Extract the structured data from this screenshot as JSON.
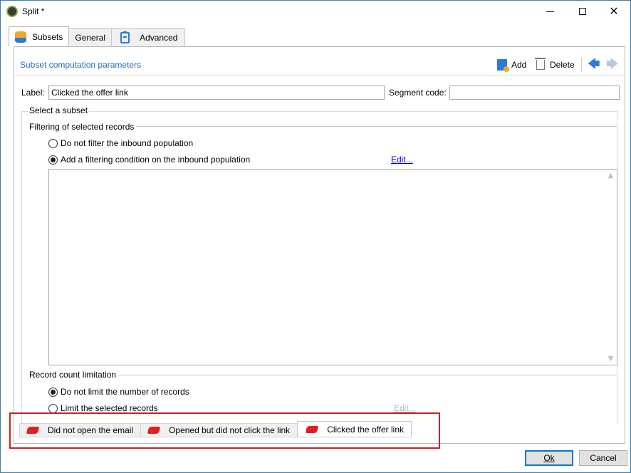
{
  "window": {
    "title": "Split *"
  },
  "tabs": [
    {
      "label": "Subsets",
      "icon": "database-icon",
      "active": true
    },
    {
      "label": "General",
      "icon": "",
      "active": false
    },
    {
      "label": "Advanced",
      "icon": "clipboard-icon",
      "active": false
    }
  ],
  "header": {
    "title": "Subset computation parameters",
    "add_label": "Add",
    "delete_label": "Delete"
  },
  "form": {
    "label_caption": "Label:",
    "label_value": "Clicked the offer link",
    "segment_caption": "Segment code:",
    "segment_value": ""
  },
  "select_subset": {
    "title": "Select a subset",
    "filtering": {
      "title": "Filtering of selected records",
      "options": [
        {
          "label": "Do not filter the inbound population",
          "checked": false
        },
        {
          "label": "Add a filtering condition on the inbound population",
          "checked": true
        }
      ],
      "edit_label": "Edit..."
    },
    "limitation": {
      "title": "Record count limitation",
      "options": [
        {
          "label": "Do not limit the number of records",
          "checked": true
        },
        {
          "label": "Limit the selected records",
          "checked": false
        }
      ],
      "edit_label": "Edit..."
    }
  },
  "subsets": [
    {
      "label": "Did not open the email",
      "active": false
    },
    {
      "label": "Opened but did not click the link",
      "active": false
    },
    {
      "label": "Clicked the offer link",
      "active": true
    }
  ],
  "buttons": {
    "ok_label": "Ok",
    "cancel_label": "Cancel"
  },
  "colors": {
    "link": "#2c6fb5",
    "accent": "#2c7bd6",
    "highlight": "#cc2222",
    "ticket": "#e02020"
  }
}
